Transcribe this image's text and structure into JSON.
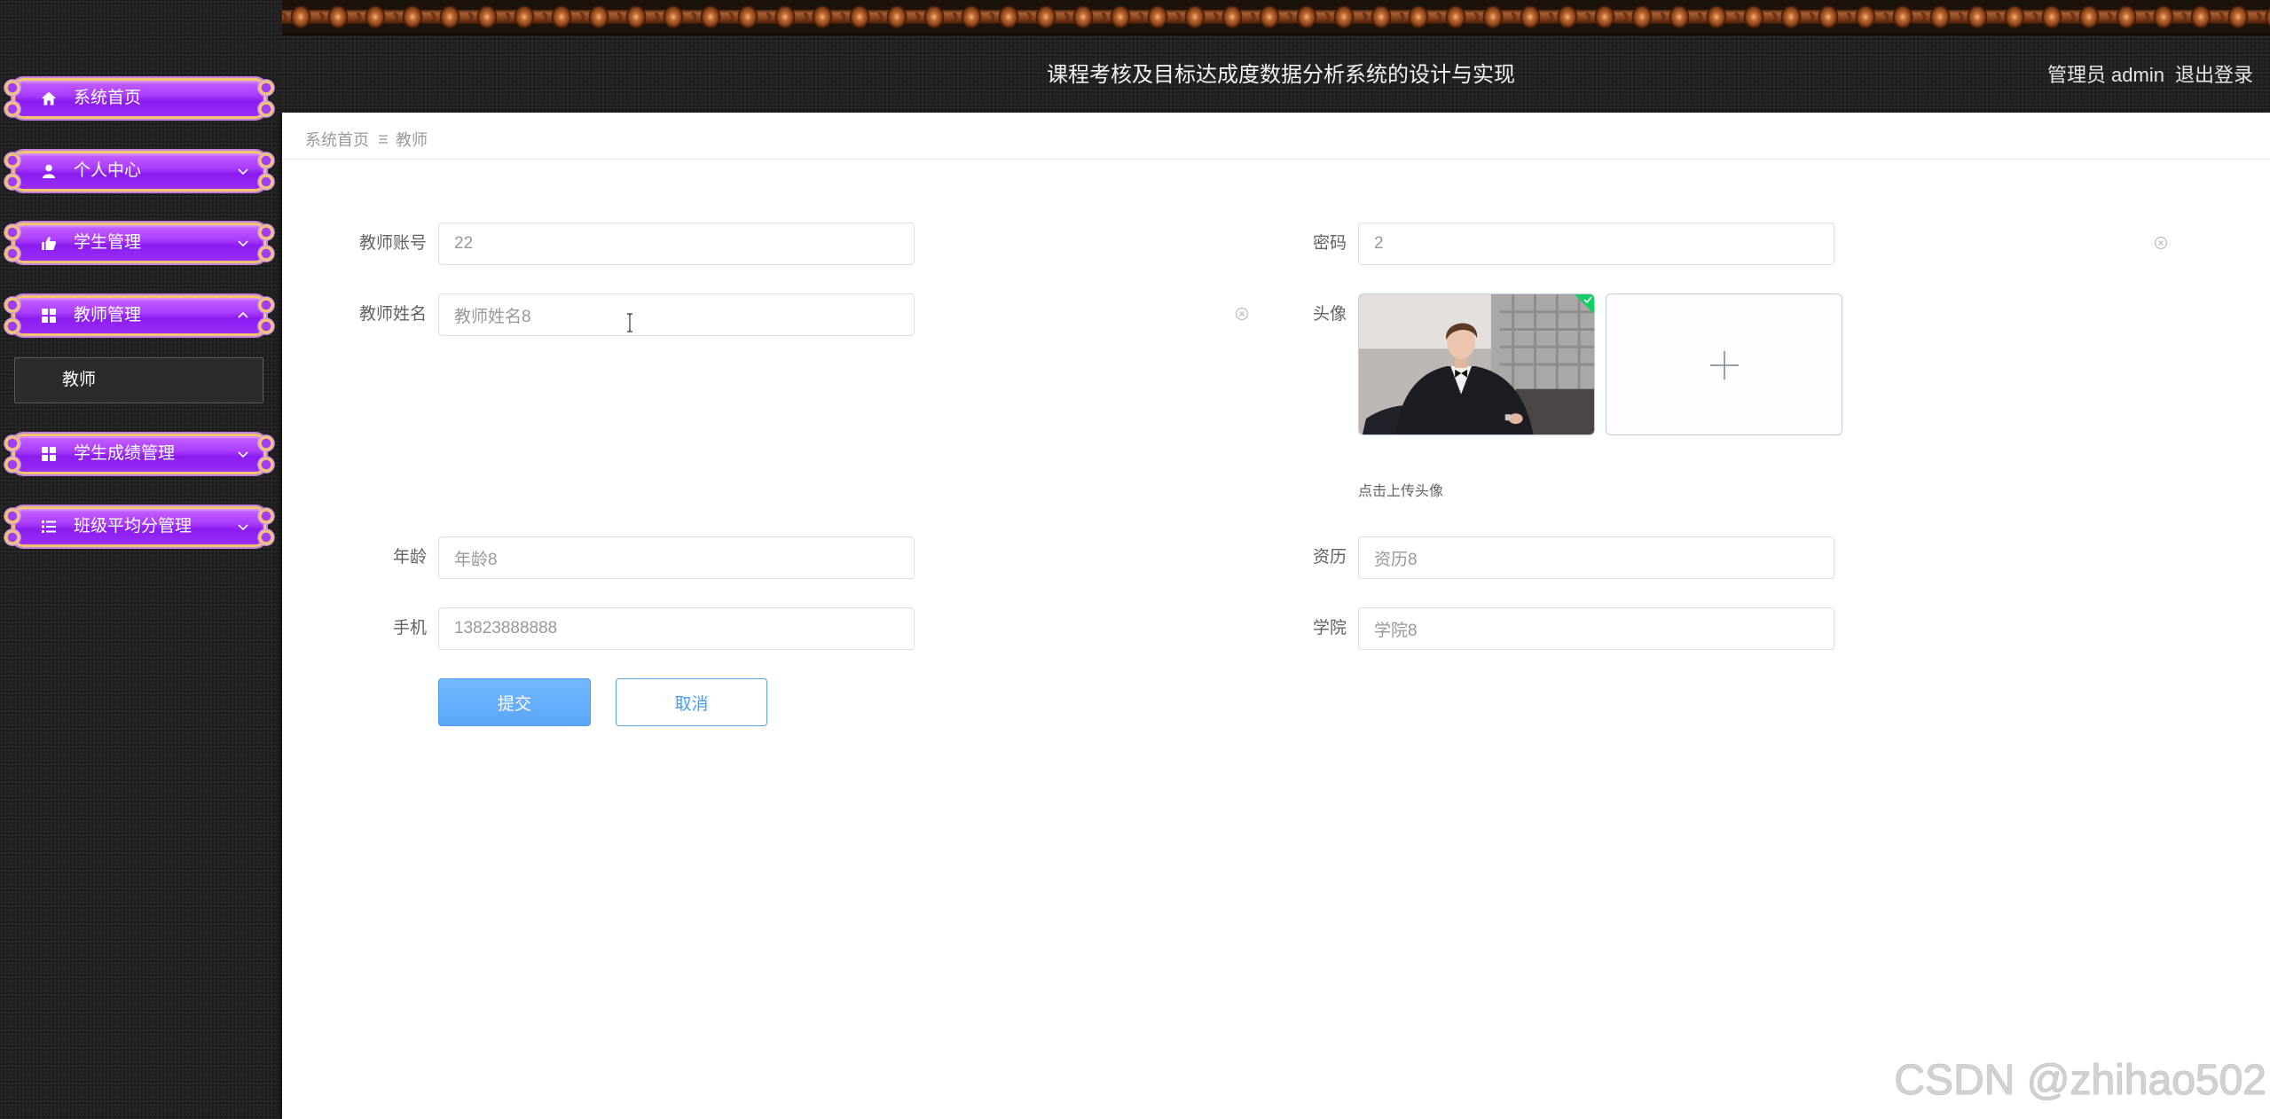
{
  "header": {
    "title": "课程考核及目标达成度数据分析系统的设计与实现",
    "user_label": "管理员 admin",
    "logout_label": "退出登录"
  },
  "breadcrumb": {
    "home": "系统首页",
    "separator_icon": "menu-lines-icon",
    "current": "教师"
  },
  "sidebar": {
    "items": [
      {
        "label": "系统首页",
        "icon": "home-icon"
      },
      {
        "label": "个人中心",
        "icon": "user-icon",
        "expanded": false
      },
      {
        "label": "学生管理",
        "icon": "thumbs-up-icon",
        "expanded": false
      },
      {
        "label": "教师管理",
        "icon": "grid-icon",
        "expanded": true,
        "children": [
          {
            "label": "教师",
            "active": true
          }
        ]
      },
      {
        "label": "学生成绩管理",
        "icon": "grid-icon",
        "expanded": false
      },
      {
        "label": "班级平均分管理",
        "icon": "list-icon",
        "expanded": false
      }
    ]
  },
  "form": {
    "teacher_account": {
      "label": "教师账号",
      "value": "22"
    },
    "password": {
      "label": "密码",
      "value": "2"
    },
    "teacher_name": {
      "label": "教师姓名",
      "value": "教师姓名8"
    },
    "avatar": {
      "label": "头像",
      "hint": "点击上传头像",
      "upload_icon": "plus-icon",
      "uploaded": true
    },
    "age": {
      "label": "年龄",
      "value": "年龄8"
    },
    "qualification": {
      "label": "资历",
      "value": "资历8"
    },
    "phone": {
      "label": "手机",
      "value": "13823888888"
    },
    "college": {
      "label": "学院",
      "value": "学院8"
    },
    "submit_label": "提交",
    "cancel_label": "取消"
  },
  "watermark": "CSDN @zhihao502",
  "colors": {
    "sidebar_bg": "#212121",
    "menu_purple": "#9b2df8",
    "menu_border": "#f3c571",
    "primary": "#409eff",
    "submit_bg": "#66b1ff",
    "upload_success": "#13ce66"
  }
}
